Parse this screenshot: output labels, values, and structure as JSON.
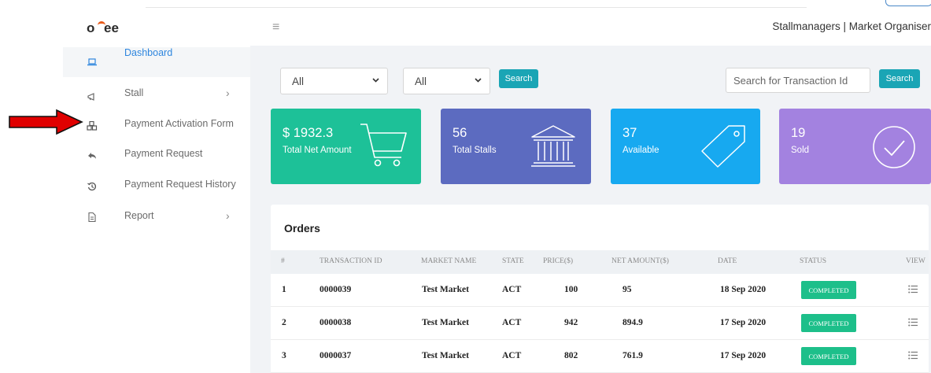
{
  "header": {
    "user_text": "Stallmanagers | Market Organiser"
  },
  "sidebar": {
    "items": [
      {
        "label": "Dashboard",
        "icon": "laptop-icon",
        "active": true
      },
      {
        "label": "Stall",
        "icon": "megaphone-icon",
        "has_submenu": true
      },
      {
        "label": "Payment Activation Form",
        "icon": "cubes-icon"
      },
      {
        "label": "Payment Request",
        "icon": "reply-icon"
      },
      {
        "label": "Payment Request History",
        "icon": "history-icon"
      },
      {
        "label": "Report",
        "icon": "document-icon",
        "has_submenu": true
      }
    ]
  },
  "filters": {
    "select1": "All",
    "select2": "All",
    "search_label": "Search",
    "txn_placeholder": "Search for Transaction Id",
    "txn_search_label": "Search"
  },
  "cards": [
    {
      "value": "$ 1932.3",
      "label": "Total Net Amount",
      "color": "#1dc198",
      "icon": "cart-icon"
    },
    {
      "value": "56",
      "label": "Total Stalls",
      "color": "#5c6bc0",
      "icon": "bank-icon"
    },
    {
      "value": "37",
      "label": "Available",
      "color": "#17a9f0",
      "icon": "tag-icon"
    },
    {
      "value": "19",
      "label": "Sold",
      "color": "#a382e0",
      "icon": "check-circle-icon"
    }
  ],
  "orders": {
    "title": "Orders",
    "columns": [
      "#",
      "TRANSACTION ID",
      "MARKET NAME",
      "STATE",
      "PRICE($)",
      "NET AMOUNT($)",
      "DATE",
      "STATUS",
      "VIEW"
    ],
    "rows": [
      {
        "n": "1",
        "txn": "0000039",
        "market": "Test Market",
        "state": "ACT",
        "price": "100",
        "net": "95",
        "date": "18 Sep 2020",
        "status": "COMPLETED"
      },
      {
        "n": "2",
        "txn": "0000038",
        "market": "Test Market",
        "state": "ACT",
        "price": "942",
        "net": "894.9",
        "date": "17 Sep 2020",
        "status": "COMPLETED"
      },
      {
        "n": "3",
        "txn": "0000037",
        "market": "Test Market",
        "state": "ACT",
        "price": "802",
        "net": "761.9",
        "date": "17 Sep 2020",
        "status": "COMPLETED"
      }
    ]
  },
  "colors": {
    "accent": "#2e86de",
    "search_button": "#1aa5b5",
    "status_completed": "#1dbf8a",
    "annotation_arrow": "#e00000"
  }
}
